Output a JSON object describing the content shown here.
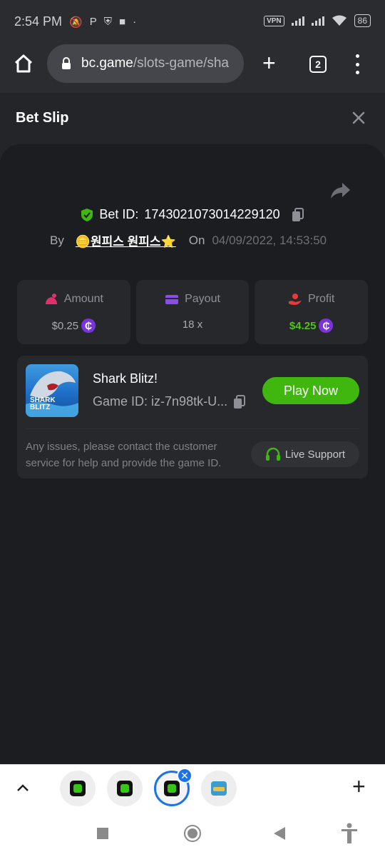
{
  "status_bar": {
    "time": "2:54 PM",
    "vpn": "VPN",
    "battery": "86"
  },
  "browser": {
    "url_host": "bc.game",
    "url_path": "/slots-game/sha",
    "tab_count": "2"
  },
  "bet_slip": {
    "title": "Bet Slip",
    "bet_id_label": "Bet ID:",
    "bet_id": "1743021073014229120",
    "by_label": "By",
    "user": "🪙원피스 원피스⭐",
    "on_label": "On",
    "date": "04/09/2022, 14:53:50"
  },
  "stats": {
    "amount_label": "Amount",
    "amount_value": "$0.25",
    "payout_label": "Payout",
    "payout_value": "18 x",
    "profit_label": "Profit",
    "profit_value": "$4.25",
    "coin_symbol": "₵"
  },
  "game": {
    "thumb_title_1": "SHARK",
    "thumb_title_2": "BLITZ",
    "name": "Shark Blitz!",
    "id_label": "Game ID:",
    "id_value": "iz-7n98tk-U...",
    "play_label": "Play Now",
    "help_text": "Any issues, please contact the customer service for help and provide the game ID.",
    "support_label": "Live Support"
  },
  "colors": {
    "accent_green": "#3fb70f",
    "profit_green": "#4ec31a",
    "coin_purple": "#7b34d9",
    "tab_blue": "#1a73e8"
  },
  "icons": {
    "home": "home-icon",
    "lock": "lock-icon",
    "share": "share-icon",
    "shield": "shield-check-icon",
    "copy": "copy-icon",
    "amount": "bag-icon",
    "payout": "card-icon",
    "profit": "hand-coin-icon",
    "support": "headset-icon"
  }
}
